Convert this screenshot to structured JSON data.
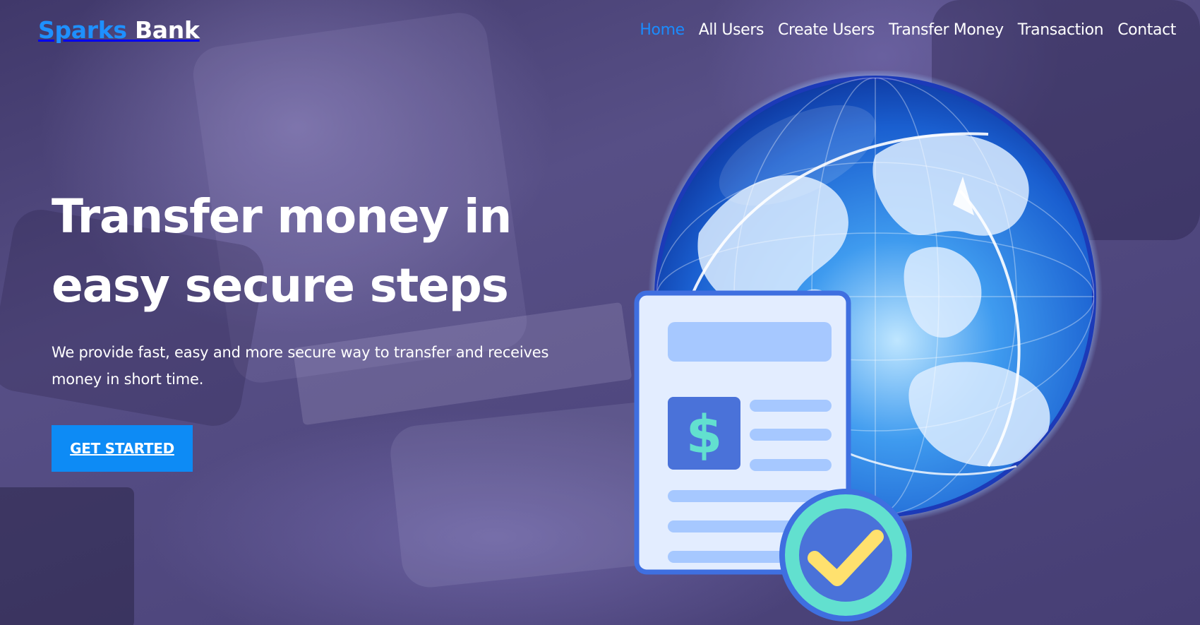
{
  "header": {
    "brand": {
      "part1": "Sparks",
      "part2": "Bank"
    },
    "nav": [
      {
        "label": "Home",
        "active": true
      },
      {
        "label": "All Users"
      },
      {
        "label": "Create Users"
      },
      {
        "label": "Transfer Money"
      },
      {
        "label": "Transaction"
      },
      {
        "label": "Contact"
      }
    ]
  },
  "hero": {
    "title_line1": "Transfer money in",
    "title_line2": "easy secure steps",
    "subtitle_line1": "We provide fast, easy and more secure way to transfer and receives",
    "subtitle_line2": "money in short time.",
    "cta_label": "GET STARTED"
  },
  "illustration": {
    "currency_symbol": "$",
    "icons": [
      "globe-icon",
      "document-icon",
      "dollar-icon",
      "checkmark-badge-icon"
    ]
  },
  "colors": {
    "accent": "#1a8cff",
    "cta_bg": "#0d8bf5",
    "overlay": "#4b4376",
    "doc_bg": "#e3edff",
    "doc_lines": "#a6c8ff",
    "doc_border": "#3f6fe0",
    "dollar_box": "#4a72d9",
    "dollar_text": "#62e0cf",
    "check_ring": "#62e0cf",
    "check_inner": "#4a72d9",
    "check_mark": "#ffe16e"
  }
}
